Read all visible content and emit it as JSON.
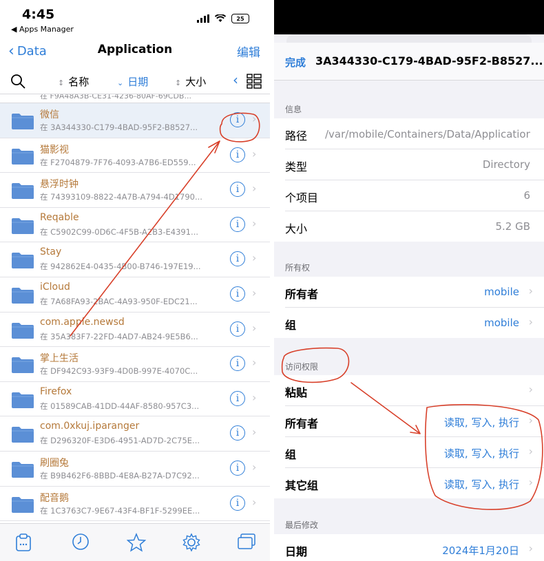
{
  "status": {
    "time": "4:45",
    "back_app": "◀ Apps Manager",
    "battery": "25"
  },
  "nav": {
    "back": "Data",
    "title": "Application",
    "edit": "编辑"
  },
  "sort": {
    "name": "名称",
    "date": "日期",
    "size": "大小"
  },
  "partial_row": "在 F9A48A3B-CE31-4236-80AF-69CDB...",
  "rows": [
    {
      "name": "微信",
      "path": "在 3A344330-C179-4BAD-95F2-B8527..."
    },
    {
      "name": "猫影视",
      "path": "在 F2704879-7F76-4093-A7B6-ED559..."
    },
    {
      "name": "悬浮时钟",
      "path": "在 74393109-8822-4A7B-A794-4D1790..."
    },
    {
      "name": "Reqable",
      "path": "在 C5902C99-0D6C-4F5B-A2B3-E4391..."
    },
    {
      "name": "Stay",
      "path": "在 942862E4-0435-4B00-B746-197E19..."
    },
    {
      "name": "iCloud",
      "path": "在 7A68FA93-2BAC-4A93-950F-EDC21..."
    },
    {
      "name": "com.apple.newsd",
      "path": "在 35A383F7-22FD-4AD7-AB24-9E5B6..."
    },
    {
      "name": "掌上生活",
      "path": "在 DF942C93-93F9-4D0B-997E-4070C..."
    },
    {
      "name": "Firefox",
      "path": "在 01589CAB-41DD-44AF-8580-957C3..."
    },
    {
      "name": "com.0xkuj.iparanger",
      "path": "在 D296320F-E3D6-4951-AD7D-2C75E..."
    },
    {
      "name": "刷圈兔",
      "path": "在 B9B462F6-8BBD-4E8A-B27A-D7C92..."
    },
    {
      "name": "配音鹅",
      "path": "在 1C3763C7-9E67-43F4-BF1F-5299EE..."
    }
  ],
  "sheet": {
    "done": "完成",
    "title": "3A344330-C179-4BAD-95F2-B8527...",
    "info_label": "信息",
    "info": {
      "path_k": "路径",
      "path_v": "/var/mobile/Containers/Data/Application",
      "type_k": "类型",
      "type_v": "Directory",
      "items_k": "个项目",
      "items_v": "6",
      "size_k": "大小",
      "size_v": "5.2 GB"
    },
    "owner_label": "所有权",
    "owner": {
      "owner_k": "所有者",
      "owner_v": "mobile",
      "group_k": "组",
      "group_v": "mobile"
    },
    "perm_label": "访问权限",
    "perm": {
      "sticky_k": "粘贴",
      "owner_k": "所有者",
      "owner_v": "读取, 写入, 执行",
      "group_k": "组",
      "group_v": "读取, 写入, 执行",
      "other_k": "其它组",
      "other_v": "读取, 写入, 执行"
    },
    "mod_label": "最后修改",
    "mod": {
      "date_k": "日期",
      "date_v": "2024年1月20日"
    }
  },
  "colors": {
    "accent": "#2f7ed8",
    "folder": "#5b8fd6",
    "annotation": "#d8402a",
    "name_text": "#b5793a"
  }
}
